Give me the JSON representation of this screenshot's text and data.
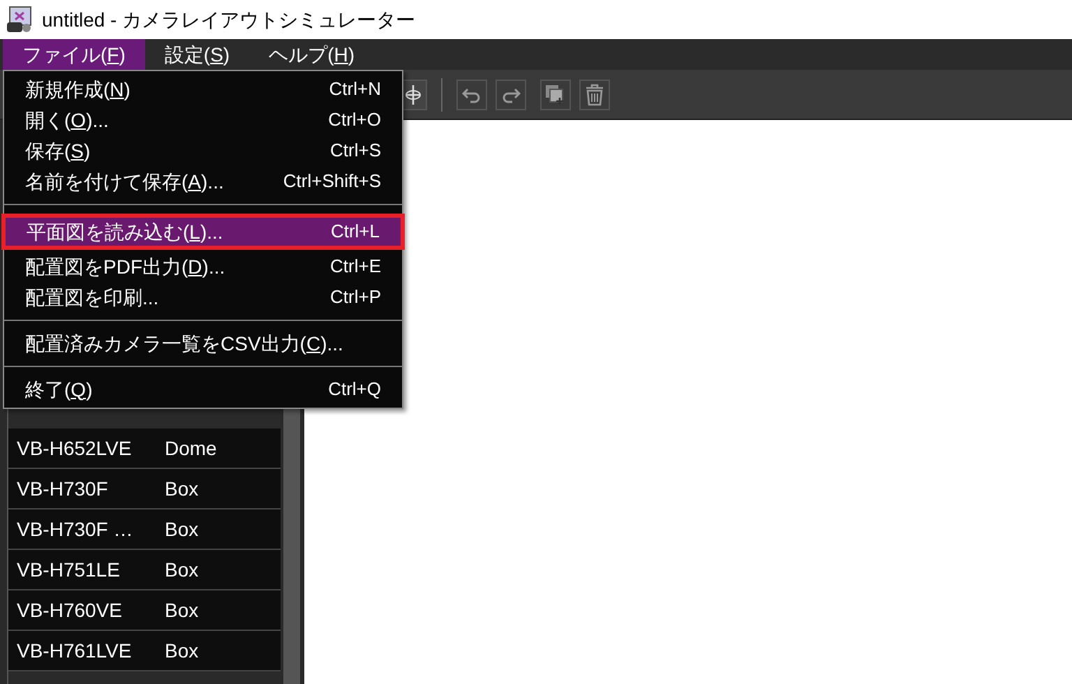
{
  "window": {
    "title": "untitled - カメラレイアウトシミュレーター"
  },
  "menu_bar": [
    {
      "label": "ファイル(",
      "mnemonic": "F",
      "label_end": ")",
      "selected": true
    },
    {
      "label": "設定(",
      "mnemonic": "S",
      "label_end": ")",
      "selected": false
    },
    {
      "label": "ヘルプ(",
      "mnemonic": "H",
      "label_end": ")",
      "selected": false
    }
  ],
  "file_menu": [
    {
      "kind": "item",
      "label": "新規作成(",
      "mnemonic": "N",
      "label_end": ")",
      "shortcut": "Ctrl+N",
      "selected": false
    },
    {
      "kind": "item",
      "label": "開く(",
      "mnemonic": "O",
      "label_end": ")...",
      "shortcut": "Ctrl+O",
      "selected": false
    },
    {
      "kind": "item",
      "label": "保存(",
      "mnemonic": "S",
      "label_end": ")",
      "shortcut": "Ctrl+S",
      "selected": false
    },
    {
      "kind": "item",
      "label": "名前を付けて保存(",
      "mnemonic": "A",
      "label_end": ")...",
      "shortcut": "Ctrl+Shift+S",
      "selected": false
    },
    {
      "kind": "separator"
    },
    {
      "kind": "item",
      "label": "平面図を読み込む(",
      "mnemonic": "L",
      "label_end": ")...",
      "shortcut": "Ctrl+L",
      "selected": true
    },
    {
      "kind": "item",
      "label": "配置図をPDF出力(",
      "mnemonic": "D",
      "label_end": ")...",
      "shortcut": "Ctrl+E",
      "selected": false
    },
    {
      "kind": "item",
      "label": "配置図を印刷...",
      "shortcut": "Ctrl+P",
      "selected": false
    },
    {
      "kind": "separator"
    },
    {
      "kind": "item",
      "label": "配置済みカメラ一覧をCSV出力(",
      "mnemonic": "C",
      "label_end": ")...",
      "selected": false
    },
    {
      "kind": "separator"
    },
    {
      "kind": "item",
      "label": "終了(",
      "mnemonic": "Q",
      "label_end": ")",
      "shortcut": "Ctrl+Q",
      "selected": false
    }
  ],
  "camera_list": [
    {
      "model": "VB-H652LVE",
      "type": "Dome"
    },
    {
      "model": "VB-H730F",
      "type": "Box"
    },
    {
      "model": "VB-H730F …",
      "type": "Box"
    },
    {
      "model": "VB-H751LE",
      "type": "Box"
    },
    {
      "model": "VB-H760VE",
      "type": "Box"
    },
    {
      "model": "VB-H761LVE",
      "type": "Box"
    }
  ]
}
